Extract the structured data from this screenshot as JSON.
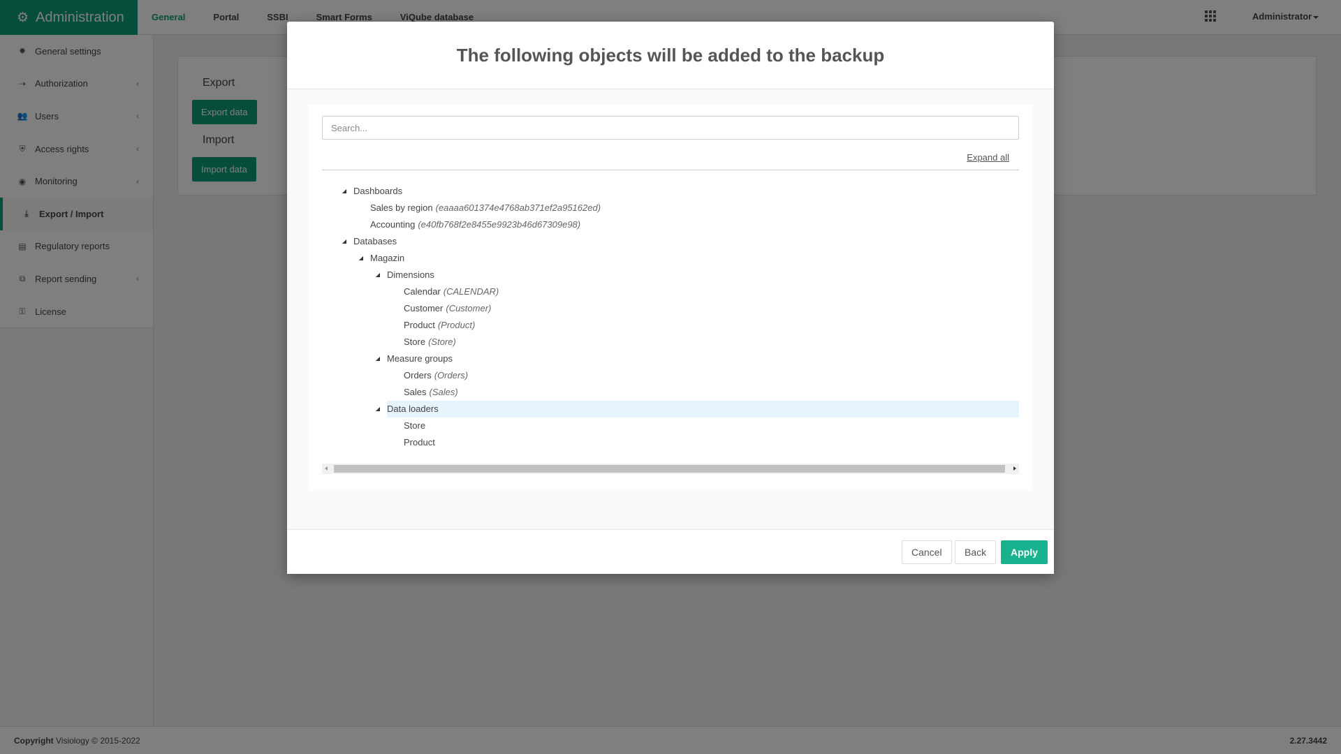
{
  "app": {
    "brand_label": "Administration",
    "user_label": "Administrator",
    "nav": [
      {
        "label": "General",
        "active": true
      },
      {
        "label": "Portal"
      },
      {
        "label": "SSBI"
      },
      {
        "label": "Smart Forms"
      },
      {
        "label": "ViQube database"
      }
    ]
  },
  "sidebar": {
    "items": [
      {
        "label": "General settings",
        "icon": "gear-icon"
      },
      {
        "label": "Authorization",
        "icon": "authorization-icon",
        "chevron": true
      },
      {
        "label": "Users",
        "icon": "users-icon",
        "chevron": true
      },
      {
        "label": "Access rights",
        "icon": "shield-icon",
        "chevron": true
      },
      {
        "label": "Monitoring",
        "icon": "monitoring-icon",
        "chevron": true
      },
      {
        "label": "Export / Import",
        "icon": "download-icon",
        "active": true
      },
      {
        "label": "Regulatory reports",
        "icon": "report-icon"
      },
      {
        "label": "Report sending",
        "icon": "copy-icon",
        "chevron": true
      },
      {
        "label": "License",
        "icon": "key-icon"
      }
    ]
  },
  "main": {
    "export_title": "Export",
    "export_button": "Export data",
    "import_title": "Import",
    "import_button": "Import data"
  },
  "modal": {
    "title": "The following objects will be added to the backup",
    "search_placeholder": "Search...",
    "expand_all": "Expand all",
    "tree": [
      {
        "label": "Dashboards",
        "level": 0,
        "expanded": true
      },
      {
        "label": "Sales by region",
        "sub": "(eaaaa601374e4768ab371ef2a95162ed)",
        "level": 1
      },
      {
        "label": "Accounting",
        "sub": "(e40fb768f2e8455e9923b46d67309e98)",
        "level": 1
      },
      {
        "label": "Databases",
        "level": 0,
        "expanded": true
      },
      {
        "label": "Magazin",
        "level": 1,
        "expanded": true
      },
      {
        "label": "Dimensions",
        "level": 2,
        "expanded": true
      },
      {
        "label": "Calendar",
        "sub": "(CALENDAR)",
        "level": 3
      },
      {
        "label": "Customer",
        "sub": "(Customer)",
        "level": 3
      },
      {
        "label": "Product",
        "sub": "(Product)",
        "level": 3
      },
      {
        "label": "Store",
        "sub": "(Store)",
        "level": 3
      },
      {
        "label": "Measure groups",
        "level": 2,
        "expanded": true
      },
      {
        "label": "Orders",
        "sub": "(Orders)",
        "level": 3
      },
      {
        "label": "Sales",
        "sub": "(Sales)",
        "level": 3
      },
      {
        "label": "Data loaders",
        "level": 2,
        "expanded": true,
        "highlighted": true
      },
      {
        "label": "Store",
        "level": 3
      },
      {
        "label": "Product",
        "level": 3
      }
    ],
    "buttons": {
      "cancel": "Cancel",
      "back": "Back",
      "apply": "Apply"
    }
  },
  "footer": {
    "copyright_label": "Copyright",
    "copyright_text": "Visiology © 2015-2022",
    "version": "2.27.3442"
  },
  "colors": {
    "brand": "#0c9d76",
    "primary_button": "#17b28e",
    "highlight_row": "#e8f4fb",
    "overlay": "rgba(0,0,0,0.5)"
  }
}
